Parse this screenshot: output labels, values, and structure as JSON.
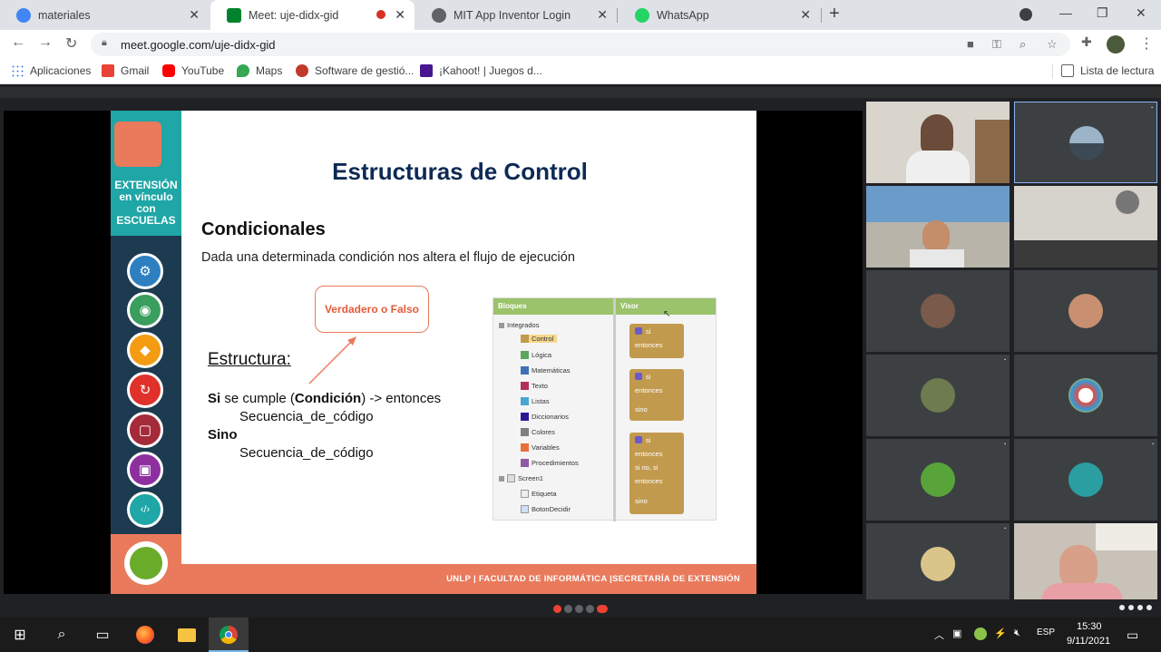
{
  "browser": {
    "tabs": [
      {
        "title": "materiales",
        "icon": "classroom-icon",
        "color": "#4285f4"
      },
      {
        "title": "Meet: uje-didx-gid",
        "icon": "meet-icon",
        "color": "#00832d",
        "recording": true
      },
      {
        "title": "MIT App Inventor Login",
        "icon": "globe-icon",
        "color": "#5f6368"
      },
      {
        "title": "WhatsApp",
        "icon": "whatsapp-icon",
        "color": "#25d366"
      }
    ],
    "url": "meet.google.com/uje-didx-gid",
    "bookmarks": [
      {
        "label": "Aplicaciones",
        "icon": "apps-icon"
      },
      {
        "label": "Gmail",
        "icon": "gmail-icon"
      },
      {
        "label": "YouTube",
        "icon": "youtube-icon"
      },
      {
        "label": "Maps",
        "icon": "maps-icon"
      },
      {
        "label": "Software de gestió...",
        "icon": "software-icon"
      },
      {
        "label": "¡Kahoot! | Juegos d...",
        "icon": "kahoot-icon"
      }
    ],
    "reading_list": "Lista de lectura"
  },
  "slide": {
    "title": "Estructuras de Control",
    "subtitle": "Condicionales",
    "description": "Dada una determinada condición nos altera el flujo de ejecución",
    "callout": "Verdadero o Falso",
    "estructura": "Estructura:",
    "line1_bold1": "Si",
    "line1_a": " se cumple (",
    "line1_bold2": "Condición",
    "line1_b": ") -> entonces",
    "line2": "Secuencia_de_código",
    "line3": "Sino",
    "line4": "Secuencia_de_código",
    "sidebar_title": "EXTENSIÓN en vínculo con ESCUELAS",
    "footer": "UNLP | FACULTAD DE INFORMÁTICA |SECRETARÍA DE EXTENSIÓN",
    "appinventor": {
      "bloques_header": "Bloques",
      "visor_header": "Visor",
      "tree": [
        "Integrados",
        "Control",
        "Lógica",
        "Matemáticas",
        "Texto",
        "Listas",
        "Diccionarios",
        "Colores",
        "Variables",
        "Procedimientos",
        "Screen1",
        "Etiqueta",
        "BotonDecidir"
      ],
      "tree_colors": [
        "",
        "#c29a4e",
        "#5ba55b",
        "#3f71b5",
        "#b32d5e",
        "#49a6d4",
        "#2d1799",
        "#7f7f7f",
        "#e8703a",
        "#8e5aa0",
        "",
        "",
        ""
      ],
      "blocks": [
        {
          "lines": [
            "si",
            "entonces"
          ]
        },
        {
          "lines": [
            "si",
            "entonces",
            "sino"
          ]
        },
        {
          "lines": [
            "si",
            "entonces",
            "si no, si",
            "entonces",
            "sino"
          ]
        }
      ]
    }
  },
  "participants": [
    "",
    "",
    "",
    "",
    "",
    "",
    "",
    "",
    "",
    "",
    "",
    ""
  ],
  "taskbar": {
    "lang": "ESP",
    "time": "15:30",
    "date": "9/11/2021"
  }
}
